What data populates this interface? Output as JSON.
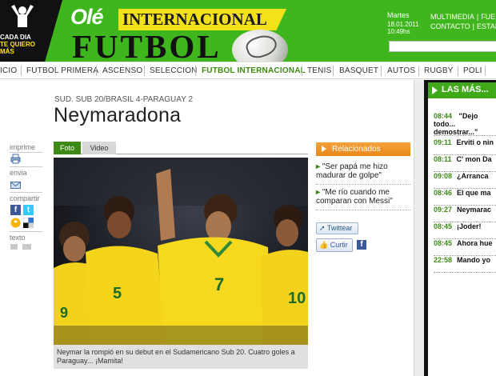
{
  "header": {
    "promo_lines": [
      "CADA DIA",
      "TE QUIERO",
      "MÁS"
    ],
    "brand": "Olé",
    "section_name": "INTERNACIONAL",
    "sport_word": "FUTBOL",
    "date": {
      "weekday": "Martes",
      "date": "18.01.2011",
      "time": "10:49hs"
    },
    "util_links_row1": [
      "MULTIMEDIA",
      "FUERA"
    ],
    "util_links_row2": [
      "CONTACTO",
      "ESTADIS"
    ],
    "search": {
      "value": "",
      "placeholder": ""
    },
    "colors": {
      "header_green": "#3fb61d",
      "banner_yellow": "#f3e21a"
    }
  },
  "nav": {
    "items": [
      "ICIO",
      "FUTBOL PRIMERA",
      "ASCENSO",
      "SELECCION",
      "FUTBOL INTERNACIONAL",
      "TENIS",
      "BASQUET",
      "AUTOS",
      "RUGBY",
      "POLI"
    ],
    "active": "FUTBOL INTERNACIONAL"
  },
  "article": {
    "breadcrumb": "SUD. SUB 20/BRASIL 4-PARAGUAY 2",
    "headline": "Neymaradona",
    "media_tabs": [
      "Foto",
      "Video"
    ],
    "photo_jersey_numbers": [
      "9",
      "5",
      "7",
      "10"
    ],
    "caption": "Neymar la rompió en su debut en el Sudamericano Sub 20. Cuatro goles a Paraguay... ¡Mamita!"
  },
  "share": {
    "labels": {
      "print": "imprime",
      "send": "envia",
      "share": "compartir",
      "text": "texto"
    },
    "icons": [
      "printer-icon",
      "email-icon",
      "facebook-icon",
      "twitter-icon",
      "google-buzz-icon",
      "delicious-icon",
      "text-smaller-icon",
      "text-larger-icon"
    ]
  },
  "related": {
    "title": "Relacionados",
    "items": [
      "\"Ser papá me hizo madurar de golpe\"",
      "\"Me río cuando me comparan con Messi\""
    ],
    "twitter_label": "Twittear",
    "like_label": "Curtir",
    "fb_share_label": "f"
  },
  "las_mas": {
    "title": "LAS MÁS...",
    "items": [
      {
        "time": "08:44",
        "title": "\"Dejo todo... demostrar...\""
      },
      {
        "time": "09:11",
        "title": "Erviti o nin"
      },
      {
        "time": "08:11",
        "title": "C' mon Da"
      },
      {
        "time": "09:08",
        "title": "¿Arranca"
      },
      {
        "time": "08:46",
        "title": "El que ma"
      },
      {
        "time": "09:27",
        "title": "Neymarac"
      },
      {
        "time": "08:45",
        "title": "¡Joder!"
      },
      {
        "time": "08:45",
        "title": "Ahora hue"
      },
      {
        "time": "22:58",
        "title": "Mando yo"
      }
    ]
  }
}
